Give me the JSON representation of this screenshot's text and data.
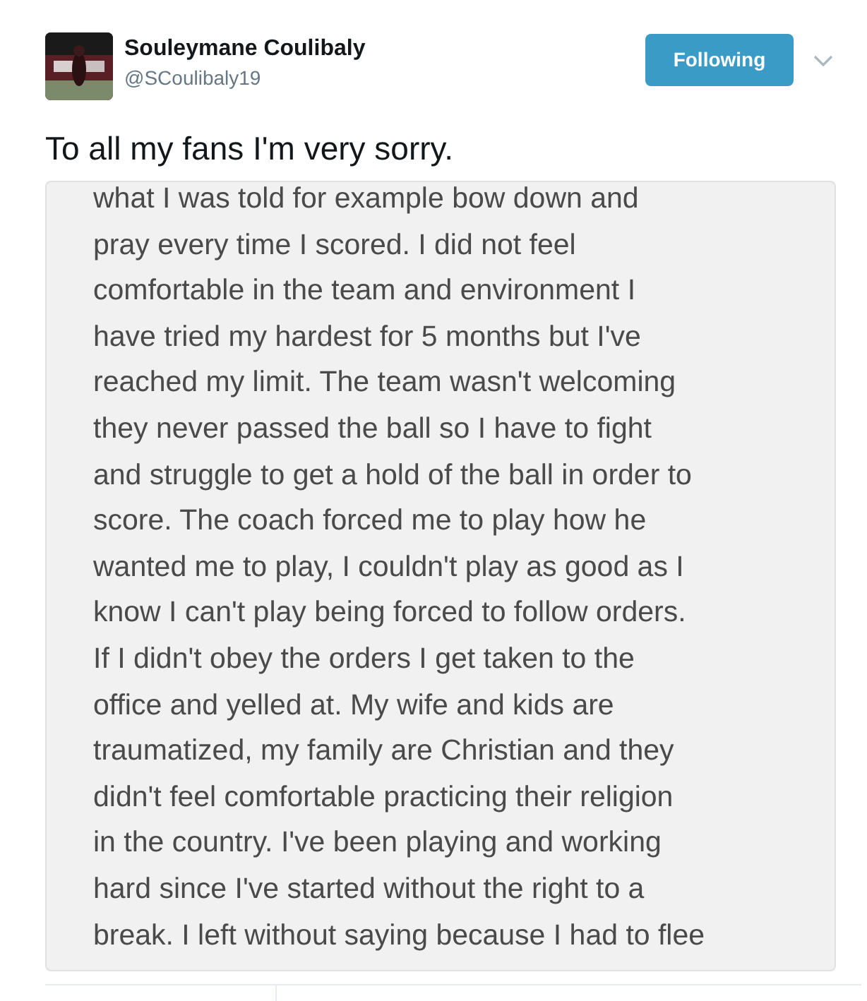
{
  "author": {
    "name": "Souleymane Coulibaly",
    "handle": "@SCoulibaly19"
  },
  "follow_button": {
    "label": "Following"
  },
  "tweet_text": "To all my fans I'm very sorry.",
  "attached_note": {
    "lines": [
      "what I was told  for example bow down and",
      "pray every time I scored. I did not feel",
      "comfortable in the team and environment I",
      "have tried my hardest for 5 months but I've",
      "reached my limit. The team wasn't welcoming",
      "they never passed the ball so I have to fight",
      "and struggle to get a hold of the ball in order to",
      "score. The coach forced me to play how he",
      "wanted me to play, I couldn't play as good as I",
      "know I can't play being forced to follow orders.",
      "If I didn't obey the orders I get taken to the",
      "office and yelled at. My wife and kids are",
      "traumatized, my family are Christian and they",
      "didn't feel comfortable practicing their religion",
      "in the country. I've been playing and working",
      "hard since I've started without the right to a",
      "break. I left without saying because I had to flee"
    ]
  }
}
